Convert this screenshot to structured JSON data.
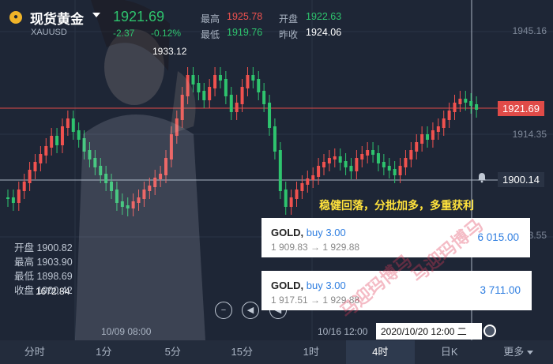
{
  "header": {
    "symbol_name": "现货黄金",
    "symbol_code": "XAUUSD",
    "price": "1921.69",
    "change": "-2.37",
    "change_pct": "-0.12%",
    "stats": {
      "high_label": "最高",
      "high_value": "1925.78",
      "open_label": "开盘",
      "open_value": "1922.63",
      "low_label": "最低",
      "low_value": "1919.76",
      "prev_label": "昨收",
      "prev_value": "1924.06"
    }
  },
  "axis": {
    "y_labels": [
      "1945.16",
      "1914.35",
      "1883.55"
    ],
    "current_price_tag": "1921.69",
    "crosshair_price_tag": "1900.14",
    "peak_label": "1933.12",
    "trough_label": "1672.84",
    "x_labels": [
      "10/09 08:00",
      "10/16 12:00"
    ],
    "crosshair_date": "2020/10/20 12:00 二"
  },
  "ohlc": {
    "open": "开盘 1900.82",
    "high": "最高 1903.90",
    "low": "最低 1898.69",
    "close": "收盘 1900.42"
  },
  "overlay": {
    "slogan": "稳健回落，分批加多，多重获利",
    "cards": [
      {
        "symbol": "GOLD,",
        "side": "buy 3.00",
        "range": "1 909.83 → 1 929.88",
        "amount": "6 015.00"
      },
      {
        "symbol": "GOLD,",
        "side": "buy 3.00",
        "range": "1 917.51 → 1 929.88",
        "amount": "3 711.00"
      }
    ],
    "watermark": "马迎玛博马"
  },
  "tabs": [
    "分时",
    "1分",
    "5分",
    "15分",
    "1时",
    "4时",
    "日K",
    "更多"
  ],
  "active_tab": "4时",
  "colors": {
    "up": "#f0524f",
    "down": "#2ec46e",
    "bg": "#1e2636",
    "accent": "#2f7ee0"
  }
}
